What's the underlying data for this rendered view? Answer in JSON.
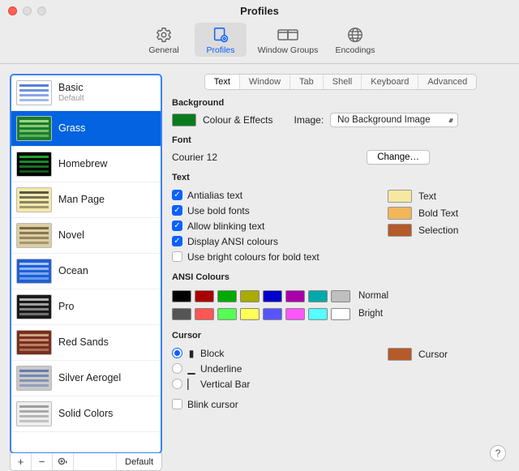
{
  "window": {
    "title": "Profiles"
  },
  "toolbar": {
    "items": [
      {
        "id": "general",
        "label": "General"
      },
      {
        "id": "profiles",
        "label": "Profiles"
      },
      {
        "id": "wingroups",
        "label": "Window Groups"
      },
      {
        "id": "encodings",
        "label": "Encodings"
      }
    ],
    "selected": "profiles"
  },
  "profiles": {
    "items": [
      {
        "name": "Basic",
        "sub": "Default",
        "bg": "#ffffff",
        "fg": "#2b5fd1"
      },
      {
        "name": "Grass",
        "bg": "#157f2c",
        "fg": "#c9e89a"
      },
      {
        "name": "Homebrew",
        "bg": "#000000",
        "fg": "#27c93f"
      },
      {
        "name": "Man Page",
        "bg": "#f5e9a7",
        "fg": "#333333"
      },
      {
        "name": "Novel",
        "bg": "#d9cfa5",
        "fg": "#6a4a2a"
      },
      {
        "name": "Ocean",
        "bg": "#1f5fd8",
        "fg": "#c8e1ff"
      },
      {
        "name": "Pro",
        "bg": "#1a1a1a",
        "fg": "#dddddd"
      },
      {
        "name": "Red Sands",
        "bg": "#7a2e1f",
        "fg": "#e4c19a"
      },
      {
        "name": "Silver Aerogel",
        "bg": "#c9c9c9",
        "fg": "#4a6aa8"
      },
      {
        "name": "Solid Colors",
        "bg": "#eeeeee",
        "fg": "#888888"
      }
    ],
    "selected": 1,
    "footer": {
      "default": "Default"
    }
  },
  "tabs": {
    "items": [
      "Text",
      "Window",
      "Tab",
      "Shell",
      "Keyboard",
      "Advanced"
    ],
    "selected": 0
  },
  "background": {
    "heading": "Background",
    "colour_label": "Colour & Effects",
    "colour": "#0a7a1f",
    "image_label": "Image:",
    "image_value": "No Background Image"
  },
  "font": {
    "heading": "Font",
    "value": "Courier 12",
    "change": "Change…"
  },
  "text": {
    "heading": "Text",
    "options": [
      {
        "label": "Antialias text",
        "on": true
      },
      {
        "label": "Use bold fonts",
        "on": true
      },
      {
        "label": "Allow blinking text",
        "on": true
      },
      {
        "label": "Display ANSI colours",
        "on": true
      },
      {
        "label": "Use bright colours for bold text",
        "on": false
      }
    ],
    "swatches": [
      {
        "label": "Text",
        "c": "#f7e8a0"
      },
      {
        "label": "Bold Text",
        "c": "#f2b65a"
      },
      {
        "label": "Selection",
        "c": "#b55a2a"
      }
    ]
  },
  "ansi": {
    "heading": "ANSI Colours",
    "normal_label": "Normal",
    "bright_label": "Bright",
    "normal": [
      "#000000",
      "#aa0000",
      "#00aa00",
      "#aaaa00",
      "#0000cc",
      "#aa00aa",
      "#00aaaa",
      "#bfbfbf"
    ],
    "bright": [
      "#555555",
      "#ff5555",
      "#55ff55",
      "#ffff55",
      "#5555ff",
      "#ff55ff",
      "#55ffff",
      "#ffffff"
    ]
  },
  "cursor": {
    "heading": "Cursor",
    "options": [
      {
        "label": "Block",
        "on": true,
        "glyph": "▮"
      },
      {
        "label": "Underline",
        "on": false,
        "glyph": "▁"
      },
      {
        "label": "Vertical Bar",
        "on": false,
        "glyph": "▏"
      }
    ],
    "blink": {
      "label": "Blink cursor",
      "on": false
    },
    "swatch": {
      "label": "Cursor",
      "c": "#b55a2a"
    }
  }
}
